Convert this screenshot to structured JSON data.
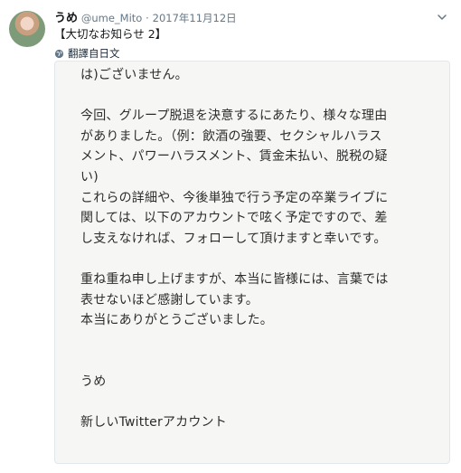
{
  "user": {
    "name": "うめ",
    "handle": "@ume_Mito",
    "separator": "·",
    "timestamp": "2017年11月12日"
  },
  "tweet": {
    "text": "【大切なお知らせ 2】",
    "translate_label": "翻譯自日文"
  },
  "image": {
    "lines": [
      "は)ございません。",
      "",
      "今回、グループ脱退を決意するにあたり、様々な理由",
      "がありました。（例：飲酒の強要、セクシャルハラス",
      "メント、パワーハラスメント、賃金未払い、脱税の疑",
      "い)",
      "これらの詳細や、今後単独で行う予定の卒業ライブに",
      "関しては、以下のアカウントで呟く予定ですので、差",
      "し支えなければ、フォローして頂けますと幸いです。",
      "",
      "重ね重ね申し上げますが、本当に皆様には、言葉では",
      "表せないほど感謝しています。",
      "本当にありがとうございました。",
      "",
      "",
      "うめ",
      "",
      "新しいTwitterアカウント"
    ]
  }
}
